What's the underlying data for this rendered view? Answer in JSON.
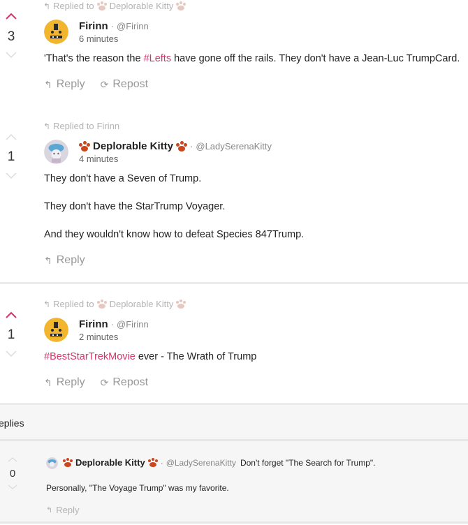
{
  "posts": [
    {
      "replied_to_label": "Replied to",
      "replied_to_name": "Deplorable Kitty",
      "score": "3",
      "voted_up": true,
      "author": "Firinn",
      "handle": "@Firinn",
      "time": "6 minutes",
      "body_pre": "'That's the reason the ",
      "hashtag": "#Lefts",
      "body_post": " have gone off the rails. They don't have a Jean-Luc TrumpCard.",
      "reply_label": "Reply",
      "repost_label": "Repost"
    },
    {
      "replied_to_label": "Replied to",
      "replied_to_name": "Firinn",
      "score": "1",
      "voted_up": false,
      "author": "Deplorable Kitty",
      "handle": "@LadySerenaKitty",
      "time": "4 minutes",
      "lines": [
        "They don't have a Seven of Trump.",
        "They don't have the StarTrump Voyager.",
        "And they wouldn't know how to defeat Species 847Trump."
      ],
      "reply_label": "Reply"
    },
    {
      "replied_to_label": "Replied to",
      "replied_to_name": "Deplorable Kitty",
      "score": "1",
      "voted_up": true,
      "author": "Firinn",
      "handle": "@Firinn",
      "time": "2 minutes",
      "hashtag": "#BestStarTrekMovie",
      "body_post": " ever - The Wrath of Trump",
      "reply_label": "Reply",
      "repost_label": "Repost"
    }
  ],
  "replies_header": "eplies",
  "sub_reply": {
    "score": "0",
    "author": "Deplorable Kitty",
    "handle": "@LadySerenaKitty",
    "inline_text": "Don't forget \"The Search for Trump\".",
    "line2": "Personally, \"The Voyage Trump\" was my favorite.",
    "reply_label": "Reply"
  },
  "colors": {
    "accent": "#d6336c",
    "muted": "#999999",
    "separator": "#ececec"
  },
  "icons": [
    "chevron-up-icon",
    "chevron-down-icon",
    "reply-arrow-icon",
    "repost-icon",
    "paw-icon"
  ]
}
